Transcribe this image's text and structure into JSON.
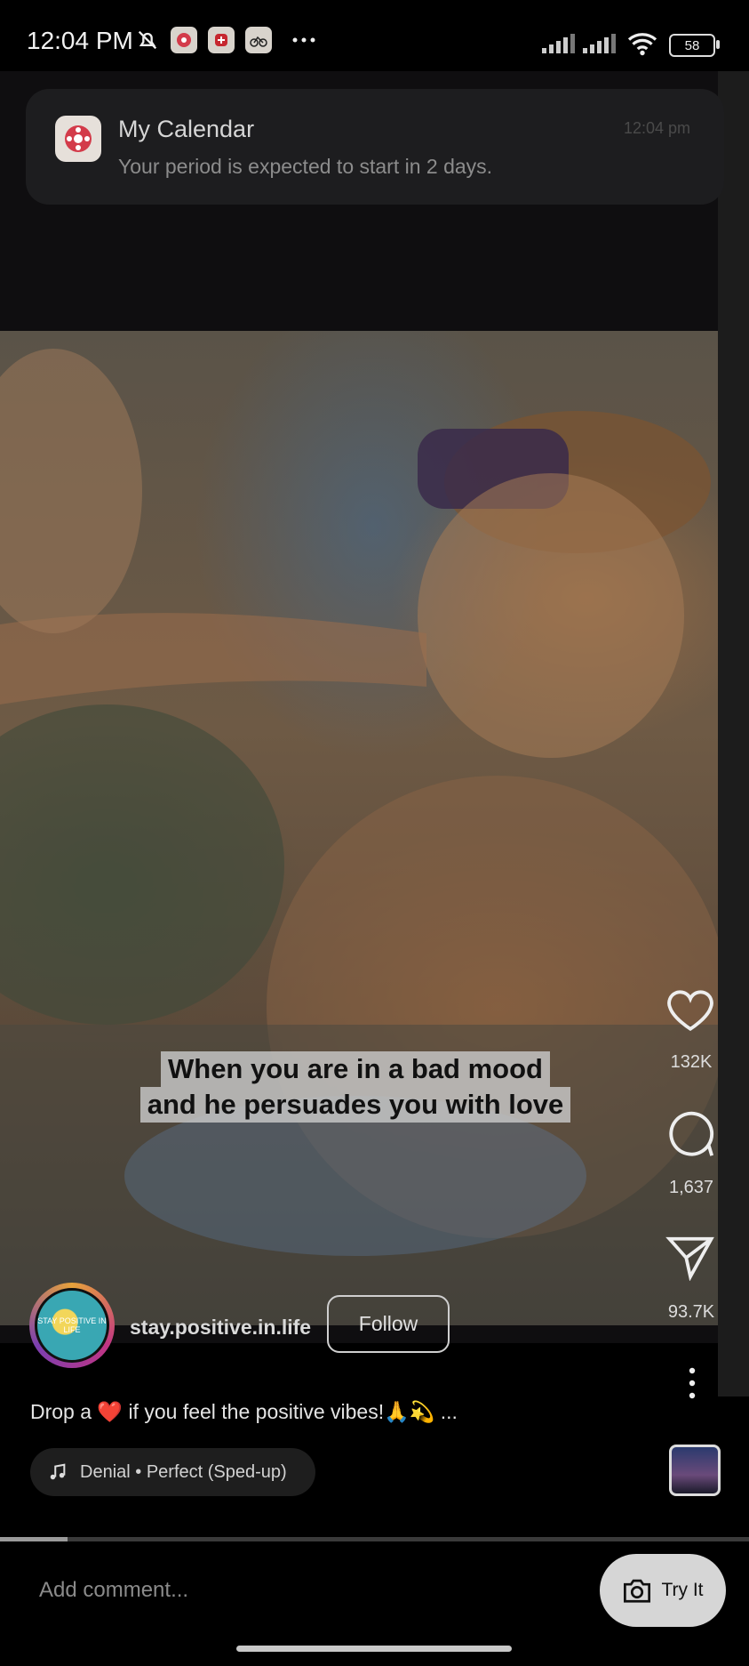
{
  "status_bar": {
    "time": "12:04 PM",
    "battery": "58",
    "icons": [
      "bell-off-icon",
      "calendar-app-icon",
      "health-app-icon",
      "cycling-app-icon",
      "more-dots-icon",
      "signal-icon",
      "signal-icon",
      "wifi-icon",
      "battery-icon"
    ]
  },
  "notification": {
    "app_name": "My Calendar",
    "time": "12:04 pm",
    "message": "Your period is expected to start in 2 days."
  },
  "video": {
    "caption_line1": "When you are in a bad mood",
    "caption_line2": "and he persuades you with love"
  },
  "actions": {
    "likes": "132K",
    "comments": "1,637",
    "shares": "93.7K"
  },
  "creator": {
    "username": "stay.positive.in.life",
    "avatar_text": "STAY POSITIVE IN LIFE",
    "follow_label": "Follow"
  },
  "post": {
    "description": "Drop a ❤️ if you feel the positive vibes!🙏💫 ...",
    "music": "Denial • Perfect (Sped-up)",
    "progress": 0.09
  },
  "comment_bar": {
    "placeholder": "Add comment...",
    "try_it_label": "Try It"
  },
  "colors": {
    "background": "#000000",
    "heart": "#e0245e",
    "notification_bg": "#1d1d1f"
  }
}
